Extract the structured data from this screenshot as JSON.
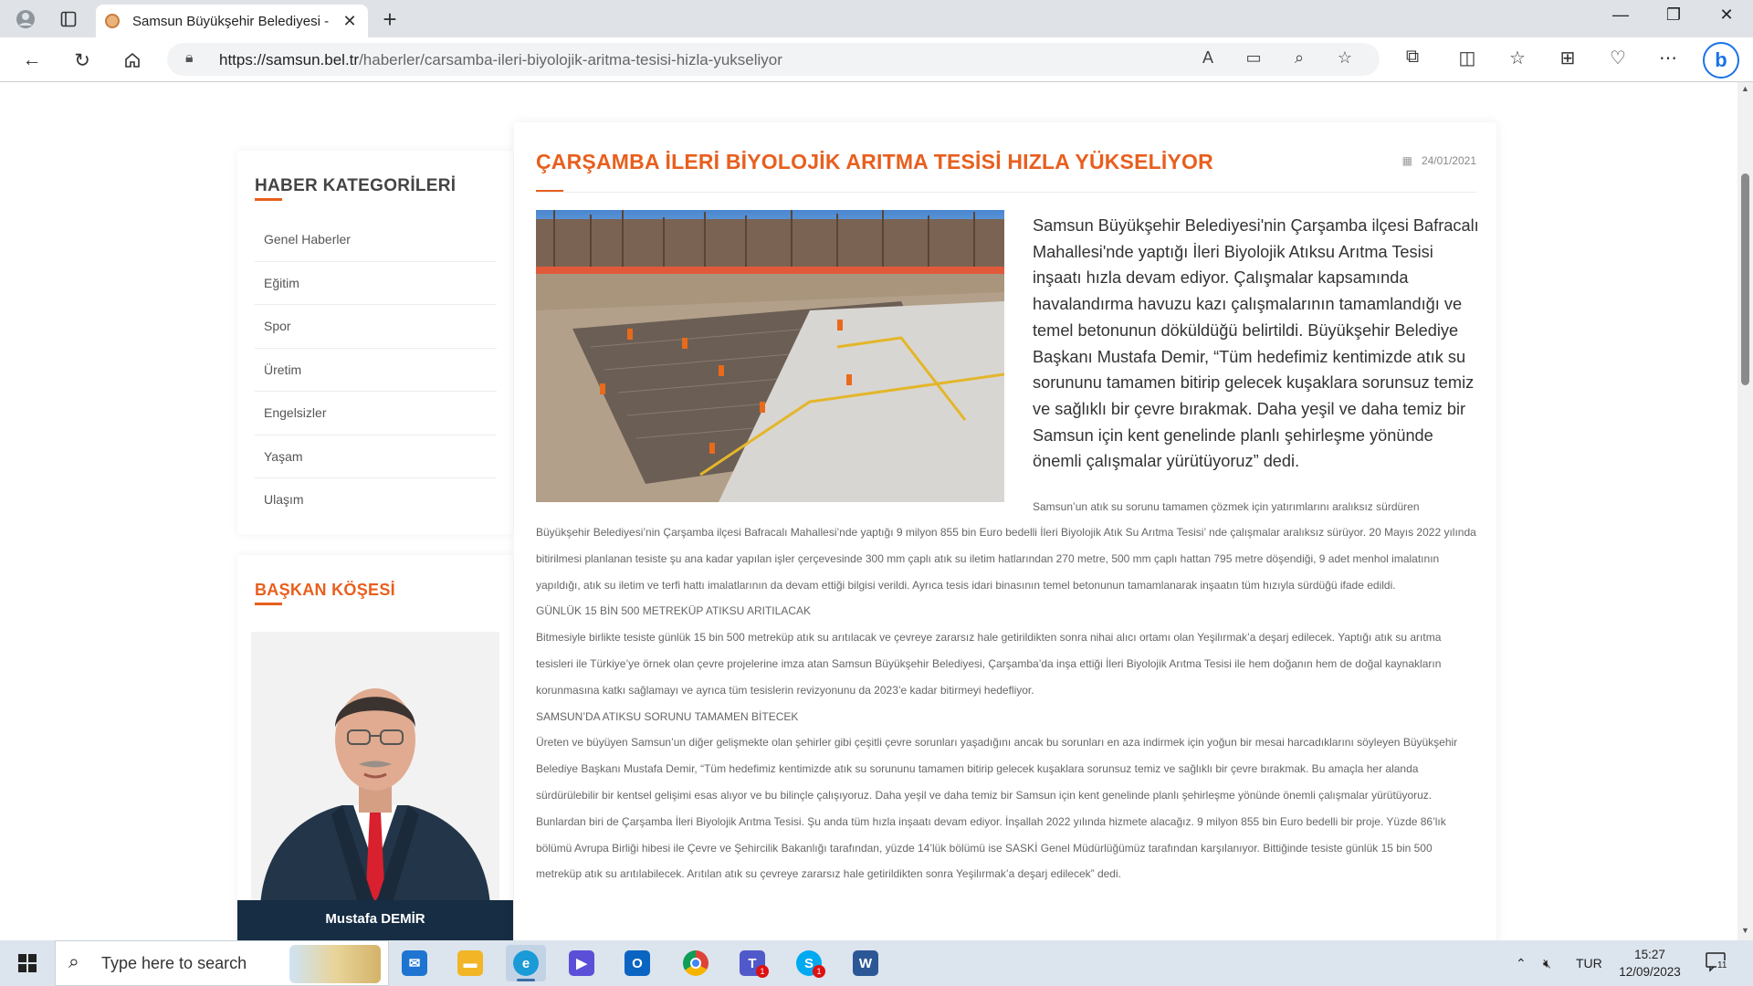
{
  "browser": {
    "tab_title": "Samsun Büyükşehir Belediyesi -",
    "url_domain": "https://samsun.bel.tr",
    "url_path": "/haberler/carsamba-ileri-biyolojik-aritma-tesisi-hizla-yukseliyor"
  },
  "sidebar": {
    "categories_title": "HABER KATEGORİLERİ",
    "categories": [
      "Genel Haberler",
      "Eğitim",
      "Spor",
      "Üretim",
      "Engelsizler",
      "Yaşam",
      "Ulaşım"
    ],
    "baskan_title": "BAŞKAN KÖŞESİ",
    "baskan_name": "Mustafa DEMİR"
  },
  "article": {
    "title": "ÇARŞAMBA İLERİ BİYOLOJİK ARITMA TESİSİ HIZLA YÜKSELİYOR",
    "date": "24/01/2021",
    "lead": "Samsun Büyükşehir Belediyesi'nin Çarşamba ilçesi Bafracalı Mahallesi'nde yaptığı İleri Biyolojik Atıksu Arıtma Tesisi inşaatı hızla devam ediyor. Çalışmalar kapsamında havalandırma havuzu kazı çalışmalarının tamamlandığı ve temel betonunun döküldüğü belirtildi. Büyükşehir Belediye Başkanı Mustafa Demir, “Tüm hedefimiz kentimizde atık su sorununu tamamen bitirip gelecek kuşaklara sorunsuz temiz ve sağlıklı bir çevre bırakmak. Daha yeşil ve daha temiz bir Samsun için kent genelinde planlı şehirleşme yönünde önemli çalışmalar yürütüyoruz” dedi.",
    "body_first": "Samsun’un atık su sorunu tamamen çözmek için yatırımlarını aralıksız sürdüren",
    "body_p1": "Büyükşehir Belediyesi’nin Çarşamba ilçesi Bafracalı Mahallesi’nde yaptığı 9 milyon 855 bin Euro bedelli İleri Biyolojik Atık Su Arıtma Tesisi’ nde çalışmalar aralıksız sürüyor. 20 Mayıs 2022 yılında bitirilmesi planlanan tesiste şu ana kadar yapılan işler çerçevesinde 300 mm çaplı atık su iletim hatlarından 270 metre, 500 mm çaplı hattan 795 metre döşendiği, 9 adet menhol imalatının yapıldığı, atık su iletim ve  terfi hattı imalatlarının da devam ettiği bilgisi verildi. Ayrıca tesis idari binasının temel betonunun tamamlanarak inşaatın tüm hızıyla sürdüğü ifade edildi.",
    "sub1": "GÜNLÜK 15 BİN 500 METREKÜP ATIKSU ARITILACAK",
    "body_p2": "Bitmesiyle birlikte tesiste günlük 15 bin 500 metreküp atık su arıtılacak ve çevreye zararsız hale getirildikten sonra nihai alıcı ortamı olan Yeşilırmak’a deşarj edilecek. Yaptığı atık su arıtma tesisleri ile Türkiye’ye örnek olan çevre projelerine imza atan Samsun Büyükşehir Belediyesi, Çarşamba’da inşa ettiği İleri Biyolojik Arıtma Tesisi ile hem doğanın hem de doğal kaynakların korunmasına katkı sağlamayı ve ayrıca tüm tesislerin revizyonunu da 2023’e kadar bitirmeyi hedefliyor.",
    "sub2": "SAMSUN’DA ATIKSU SORUNU TAMAMEN BİTECEK",
    "body_p3": "Üreten ve büyüyen Samsun’un diğer gelişmekte olan şehirler gibi çeşitli çevre sorunları yaşadığını ancak bu sorunları en aza indirmek için yoğun bir mesai harcadıklarını söyleyen Büyükşehir Belediye Başkanı Mustafa Demir, “Tüm hedefimiz kentimizde atık su sorununu tamamen bitirip gelecek kuşaklara sorunsuz temiz ve sağlıklı bir çevre bırakmak. Bu amaçla her alanda sürdürülebilir bir kentsel gelişimi esas alıyor ve bu bilinçle çalışıyoruz. Daha yeşil ve daha temiz bir Samsun için kent genelinde planlı şehirleşme yönünde önemli çalışmalar yürütüyoruz. Bunlardan biri de Çarşamba İleri Biyolojik Arıtma Tesisi.  Şu anda tüm hızla inşaatı devam ediyor.  İnşallah 2022 yılında hizmete alacağız.   9 milyon 855 bin Euro bedelli bir proje. Yüzde 86’lık bölümü Avrupa Birliği hibesi ile Çevre ve Şehircilik Bakanlığı tarafından, yüzde 14’lük bölümü ise SASKİ Genel Müdürlüğümüz tarafından karşılanıyor. Bittiğinde tesiste günlük 15 bin 500 metreküp atık su arıtılabilecek. Arıtılan atık su çevreye zararsız hale getirildikten sonra Yeşilırmak’a deşarj edilecek” dedi."
  },
  "taskbar": {
    "search_placeholder": "Type here to search",
    "language": "TUR",
    "time": "15:27",
    "date": "12/09/2023",
    "notification_count": "11",
    "teams_badge": "1",
    "skype_badge": "1"
  },
  "colors": {
    "accent": "#e85f1e",
    "navy": "#162d44"
  }
}
